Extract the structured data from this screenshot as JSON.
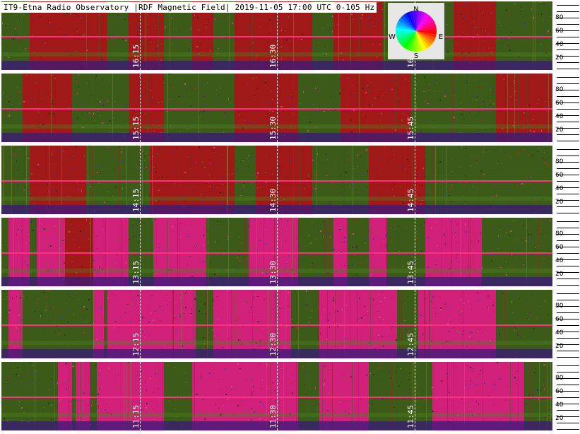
{
  "header": {
    "title": "IT9-Etna Radio Observatory |RDF Magnetic Field| 2019-11-05 17:00 UTC 0-105 Hz"
  },
  "compass": {
    "n": "N",
    "s": "S",
    "e": "E",
    "w": "W"
  },
  "y_axis_ticks": [
    "80",
    "60",
    "40",
    "20"
  ],
  "strips": [
    {
      "times": [
        "16:15",
        "16:30",
        "16:"
      ]
    },
    {
      "times": [
        "15:15",
        "15:30",
        "15:45"
      ]
    },
    {
      "times": [
        "14:15",
        "14:30",
        "14:45"
      ]
    },
    {
      "times": [
        "13:15",
        "13:30",
        "13:45"
      ]
    },
    {
      "times": [
        "12:15",
        "12:30",
        "12:45"
      ]
    },
    {
      "times": [
        "11:15",
        "11:30",
        "11:45"
      ]
    }
  ],
  "colors": {
    "bg_red": "#a01818",
    "bg_green": "#3c5a18",
    "bg_magenta": "#d0207a",
    "bg_purple": "#4a1a6a",
    "line_pink": "#ff3080"
  }
}
